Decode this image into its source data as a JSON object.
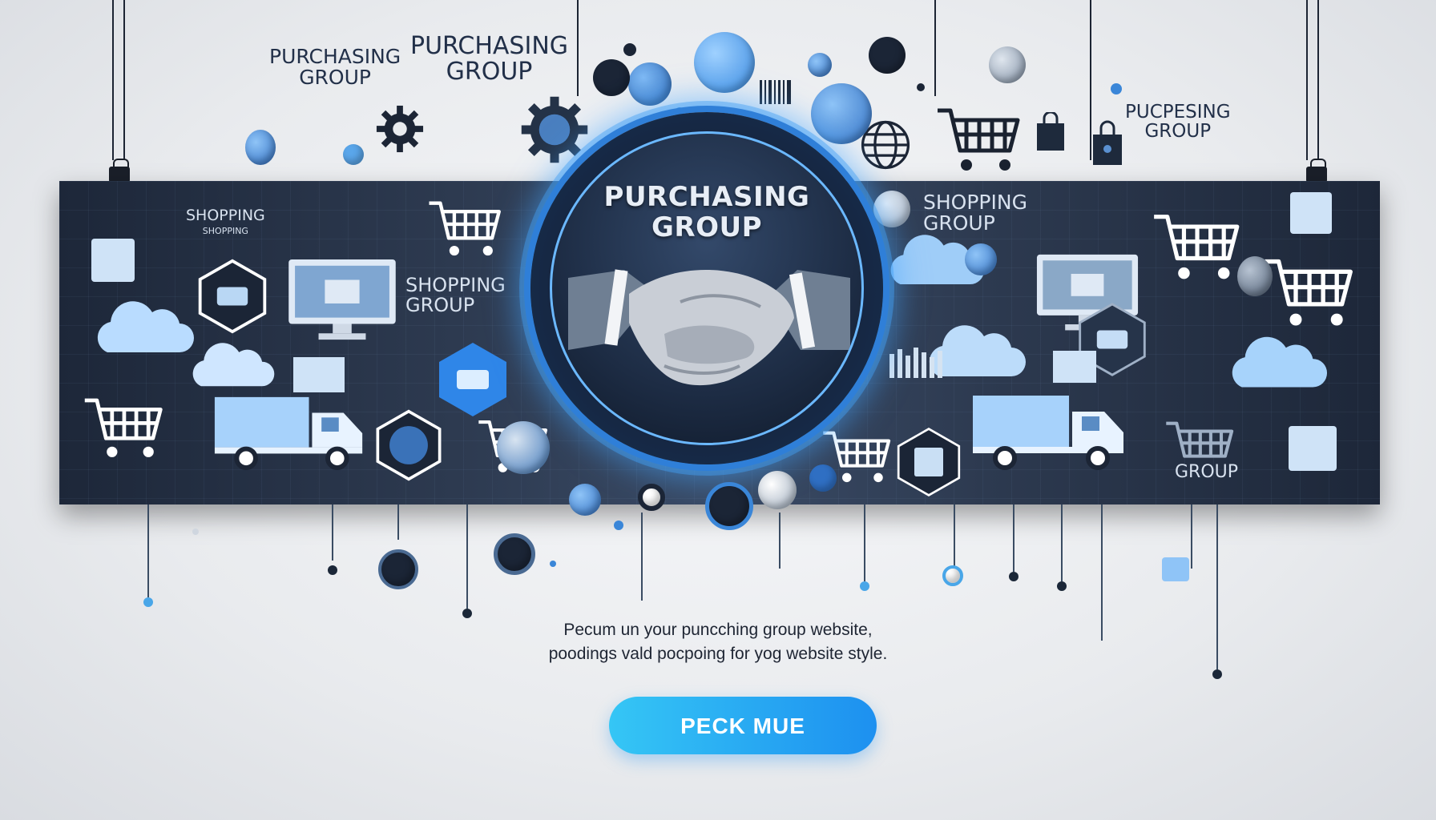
{
  "hero": {
    "title_line1": "PURCHASING",
    "title_line2": "GROUP"
  },
  "labels": {
    "top_left_small": {
      "line1": "PURCHASING",
      "line2": "GROUP"
    },
    "top_left_large": {
      "line1": "PURCHASING",
      "line2": "GROUP"
    },
    "top_right": {
      "line1": "PUCPESING",
      "line2": "GROUP"
    },
    "banner_shopping_left": "SHOPPING",
    "banner_shopping_left_sub": "SHOPPING",
    "banner_shopping_group_mid": {
      "line1": "SHOPPING",
      "line2": "GROUP"
    },
    "banner_shopping_group_right": {
      "line1": "SHOPPING",
      "line2": "GROUP"
    },
    "banner_group_bottom_right": "GROUP"
  },
  "description": {
    "line1": "Pecum un your puncching group website,",
    "line2": "poodings vald pocpoing for yog website style."
  },
  "cta": {
    "label": "PECK MUE"
  },
  "icons": {
    "center": "handshake-icon",
    "carts": "shopping-cart-icon",
    "trucks": "delivery-truck-icon",
    "clouds": "cloud-icon",
    "gear": "gear-icon",
    "globe": "globe-icon"
  },
  "colors": {
    "accent": "#1d90f0",
    "accent_light": "#35c6f5",
    "banner": "#2d3a50",
    "glow": "#43a0f5"
  }
}
